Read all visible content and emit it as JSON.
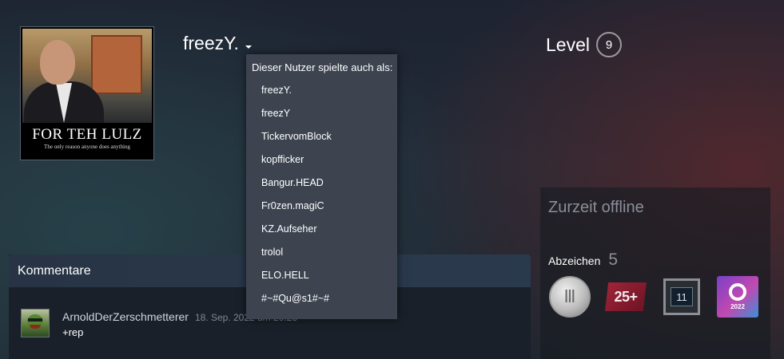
{
  "profile": {
    "persona_name": "freezY.",
    "level_label": "Level",
    "level_value": "9",
    "avatar_caption": "FOR TEH LULZ",
    "avatar_subcaption": "The only reason anyone does anything"
  },
  "aliases": {
    "heading": "Dieser Nutzer spielte auch als:",
    "items": [
      "freezY.",
      "freezY",
      "TickervomBlock",
      "kopfficker",
      "Bangur.HEAD",
      "Fr0zen.magiC",
      "KZ.Aufseher",
      "trolol",
      "ELO.HELL",
      "#~#Qu@s1#~#"
    ]
  },
  "comments": {
    "title": "Kommentare",
    "items": [
      {
        "author": "ArnoldDerZerschmetterer",
        "timestamp": "18. Sep. 2022 um 20:28",
        "text": "+rep"
      }
    ]
  },
  "status": {
    "online_status": "Zurzeit offline",
    "badges_label": "Abzeichen",
    "badges_count": "5",
    "badges": [
      {
        "icon": "silver-pillar-coin-icon",
        "glyph": "Ⅲ"
      },
      {
        "icon": "games-owned-25-plus-icon",
        "label": "25+"
      },
      {
        "icon": "years-of-service-11-icon",
        "label": "11"
      },
      {
        "icon": "steam-2022-icon",
        "label": "2022"
      }
    ]
  },
  "colors": {
    "dropdown_bg": "#3d4450",
    "muted_text": "#8a8f98",
    "comment_header": "#283445"
  }
}
